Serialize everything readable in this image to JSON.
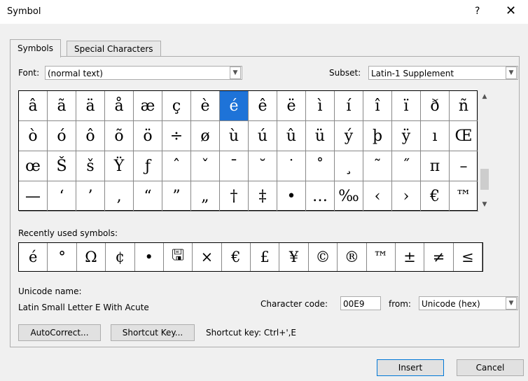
{
  "window": {
    "title": "Symbol",
    "help": "?",
    "close": "✕"
  },
  "tabs": [
    "Symbols",
    "Special Characters"
  ],
  "font": {
    "label": "Font:",
    "value": "(normal text)"
  },
  "subset": {
    "label": "Subset:",
    "value": "Latin-1 Supplement"
  },
  "symbols": [
    "â",
    "ã",
    "ä",
    "å",
    "æ",
    "ç",
    "è",
    "é",
    "ê",
    "ë",
    "ì",
    "í",
    "î",
    "ï",
    "ð",
    "ñ",
    "ò",
    "ó",
    "ô",
    "õ",
    "ö",
    "÷",
    "ø",
    "ù",
    "ú",
    "û",
    "ü",
    "ý",
    "þ",
    "ÿ",
    "ı",
    "Œ",
    "œ",
    "Š",
    "š",
    "Ÿ",
    "ƒ",
    "ˆ",
    "ˇ",
    "¯",
    "˘",
    "˙",
    "˚",
    "¸",
    "˜",
    "˝",
    "π",
    "–",
    "—",
    "‘",
    "’",
    "‚",
    "“",
    "”",
    "„",
    "†",
    "‡",
    "•",
    "…",
    "‰",
    "‹",
    "›",
    "€",
    "™"
  ],
  "selected_index": 7,
  "recent": {
    "label": "Recently used symbols:",
    "items": [
      "é",
      "°",
      "Ω",
      "¢",
      "•",
      "🖫",
      "×",
      "€",
      "£",
      "¥",
      "©",
      "®",
      "™",
      "±",
      "≠",
      "≤"
    ]
  },
  "unicode": {
    "label": "Unicode name:",
    "name": "Latin Small Letter E With Acute"
  },
  "char_code": {
    "label": "Character code:",
    "value": "00E9"
  },
  "from": {
    "label": "from:",
    "value": "Unicode (hex)"
  },
  "buttons": {
    "autocorrect": "AutoCorrect...",
    "shortcut_key": "Shortcut Key...",
    "insert": "Insert",
    "cancel": "Cancel"
  },
  "shortcut_text": "Shortcut key: Ctrl+',E"
}
